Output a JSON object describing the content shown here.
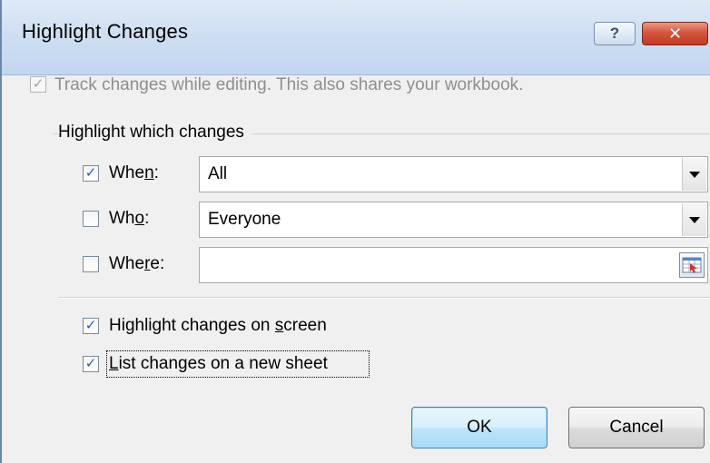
{
  "dialog": {
    "title": "Highlight Changes",
    "help_glyph": "?",
    "close_glyph": "✕"
  },
  "track": {
    "checked": true,
    "enabled": false,
    "label": "Track changes while editing. This also shares your workbook."
  },
  "group": {
    "title": "Highlight which changes",
    "when": {
      "checked": true,
      "label_pre": "Whe",
      "label_key": "n",
      "label_post": ":",
      "value": "All"
    },
    "who": {
      "checked": false,
      "label_pre": "Wh",
      "label_key": "o",
      "label_post": ":",
      "value": "Everyone"
    },
    "where": {
      "checked": false,
      "label_pre": "Whe",
      "label_key": "r",
      "label_post": "e:",
      "value": ""
    }
  },
  "options": {
    "highlight_on_screen": {
      "checked": true,
      "label_pre": "Highlight changes on ",
      "label_key": "s",
      "label_post": "creen"
    },
    "list_on_new_sheet": {
      "checked": true,
      "label_pre": "",
      "label_key": "L",
      "label_post": "ist changes on a new sheet"
    }
  },
  "buttons": {
    "ok": "OK",
    "cancel": "Cancel"
  },
  "checkmark": "✓",
  "icons": {
    "help": "help-icon",
    "close": "close-icon",
    "range_selector": "range-select-icon",
    "dropdown": "chevron-down-icon"
  }
}
